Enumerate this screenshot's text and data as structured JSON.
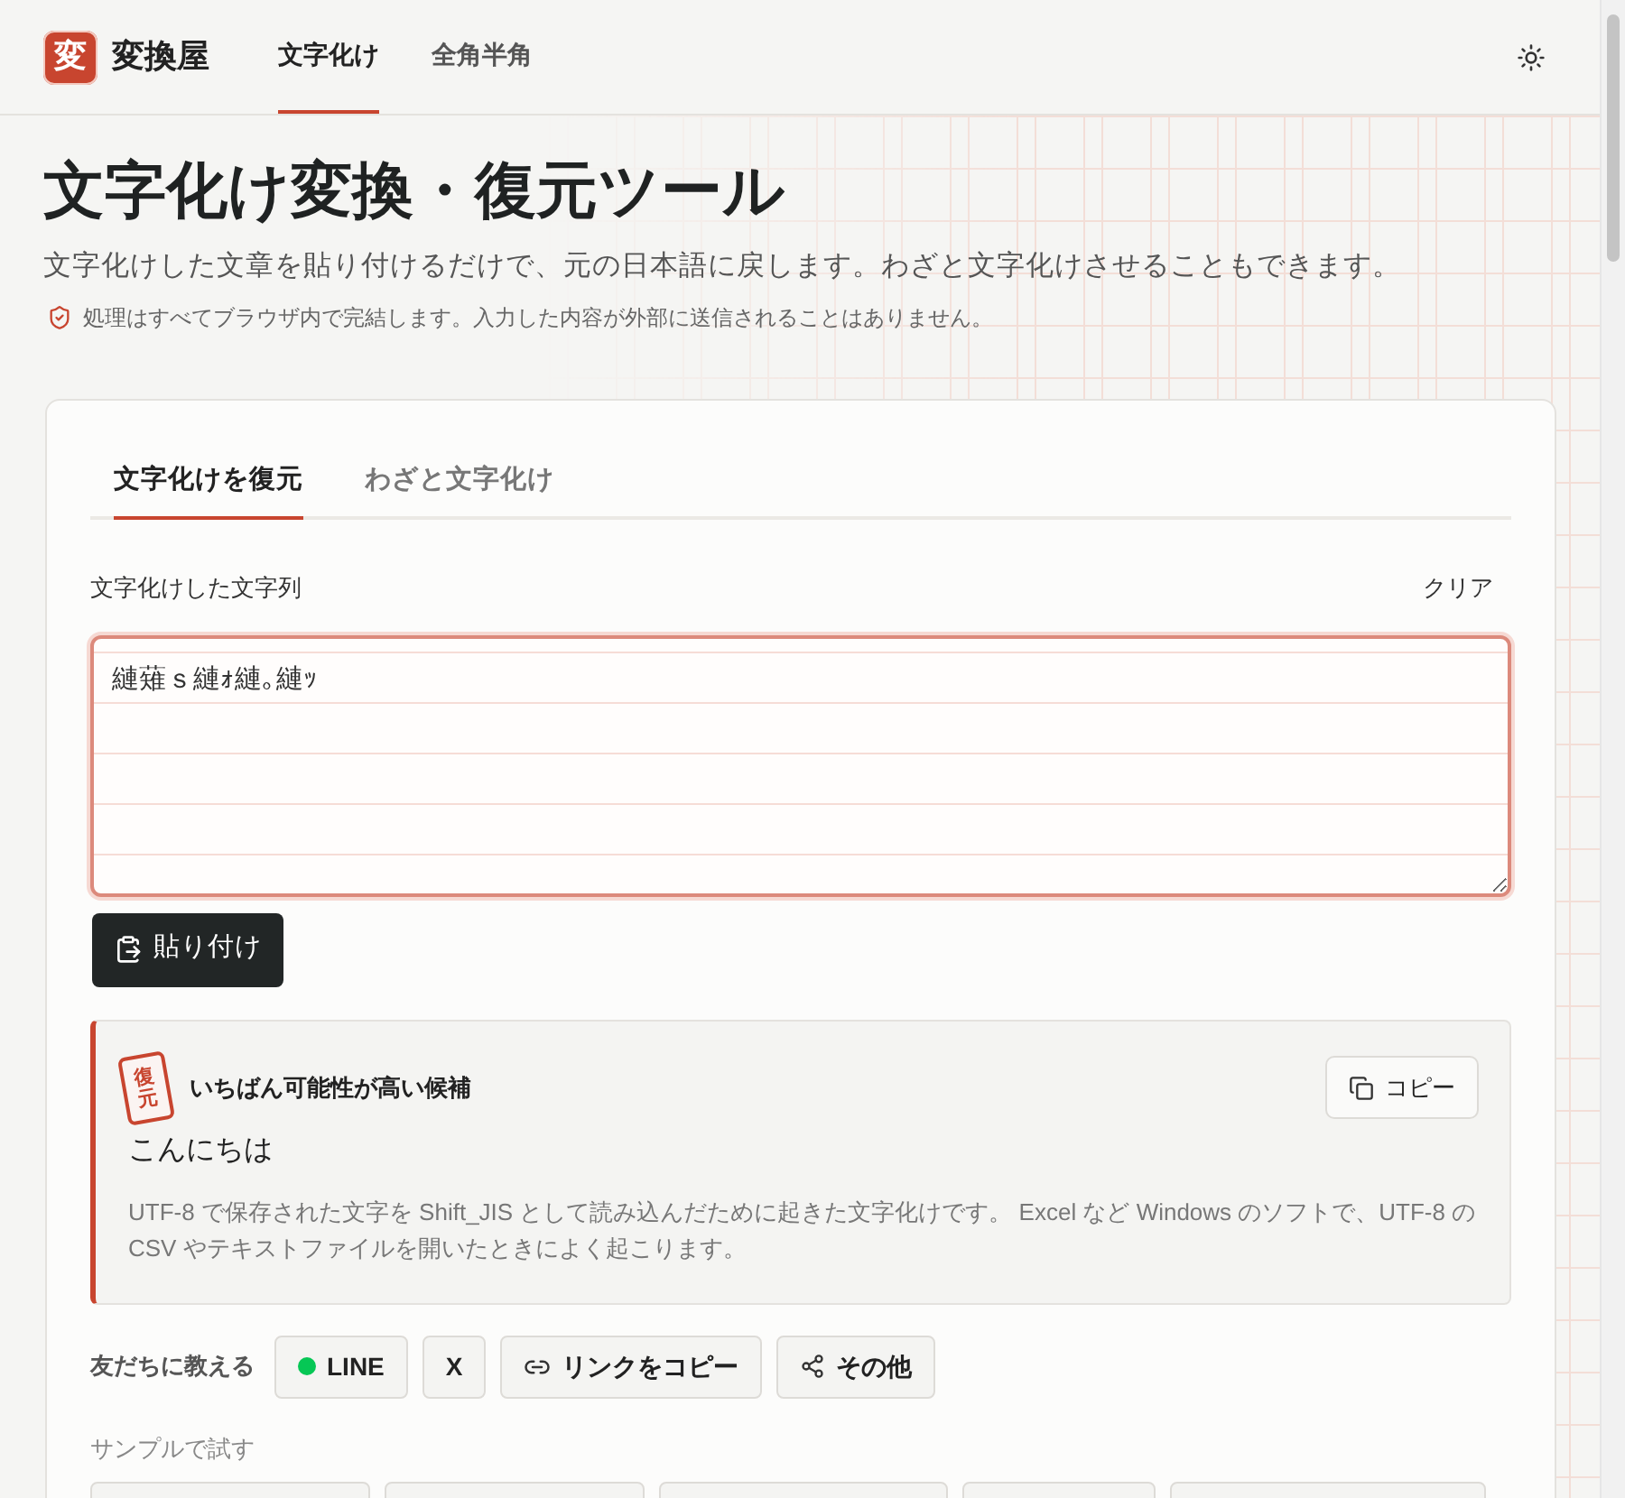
{
  "header": {
    "logo_mark": "変",
    "site_name": "変換屋",
    "nav": [
      {
        "label": "文字化け",
        "selected": true
      },
      {
        "label": "全角半角",
        "selected": false
      }
    ]
  },
  "hero": {
    "title": "文字化け変換・復元ツール",
    "subtitle": "文字化けした文章を貼り付けるだけで、元の日本語に戻します。わざと文字化けさせることもできます。",
    "privacy_note": "処理はすべてブラウザ内で完結します。入力した内容が外部に送信されることはありません。"
  },
  "tool": {
    "tabs": [
      {
        "label": "文字化けを復元",
        "selected": true
      },
      {
        "label": "わざと文字化け",
        "selected": false
      }
    ],
    "input": {
      "label": "文字化けした文字列",
      "clear_link": "クリア",
      "value": "縺薙ｓ縺ｫ縺｡縺ｯ"
    },
    "paste_button": "貼り付け",
    "result": {
      "stamp": "復元",
      "heading": "いちばん可能性が高い候補",
      "copy_button": "コピー",
      "text": "こんにちは",
      "explanation": "UTF-8 で保存された文字を Shift_JIS として読み込んだために起きた文字化けです。 Excel など Windows のソフトで、UTF-8 の CSV やテキストファイルを開いたときによく起こります。"
    },
    "share": {
      "label": "友だちに教える",
      "buttons": [
        {
          "kind": "line",
          "label": "LINE"
        },
        {
          "kind": "plain",
          "label": "X"
        },
        {
          "kind": "link",
          "label": "リンクをコピー"
        },
        {
          "kind": "share",
          "label": "その他"
        }
      ]
    },
    "samples": {
      "label": "サンプルで試す"
    }
  }
}
